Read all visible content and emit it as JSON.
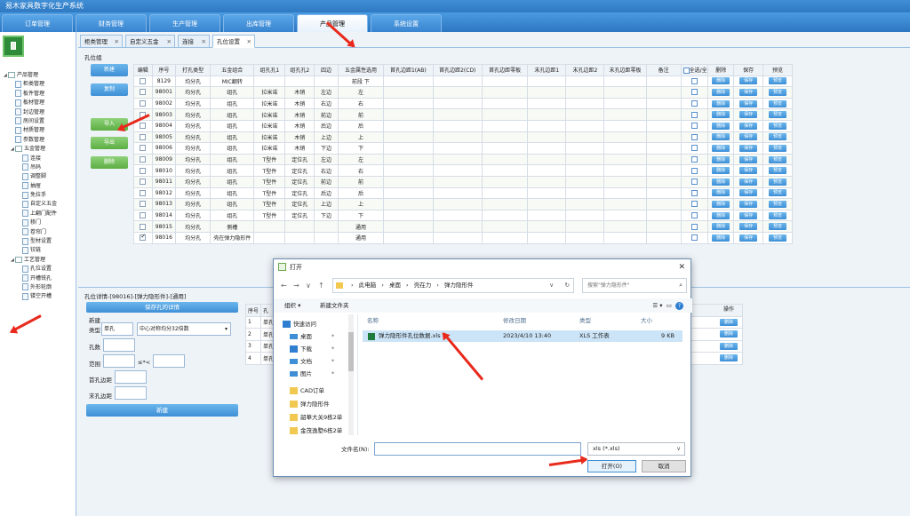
{
  "app": {
    "title": "易木家具数字化生产系统"
  },
  "topnav": [
    "订单管理",
    "财务管理",
    "生产管理",
    "出库管理",
    "产品管理",
    "系统设置"
  ],
  "tree": [
    {
      "label": "产品管理",
      "level": 0,
      "kind": "folder"
    },
    {
      "label": "柜类管理",
      "level": 1
    },
    {
      "label": "板件管理",
      "level": 1
    },
    {
      "label": "板材管理",
      "level": 1
    },
    {
      "label": "封边管理",
      "level": 1
    },
    {
      "label": "房间设置",
      "level": 1
    },
    {
      "label": "材质管理",
      "level": 1
    },
    {
      "label": "参数管理",
      "level": 1
    },
    {
      "label": "五金管理",
      "level": 1,
      "kind": "folder"
    },
    {
      "label": "连接",
      "level": 2
    },
    {
      "label": "吊码",
      "level": 2
    },
    {
      "label": "调整脚",
      "level": 2
    },
    {
      "label": "抽屉",
      "level": 2
    },
    {
      "label": "免拉手",
      "level": 2
    },
    {
      "label": "自定义五金",
      "level": 2
    },
    {
      "label": "上翻门配件",
      "level": 2
    },
    {
      "label": "移门",
      "level": 2
    },
    {
      "label": "卷帘门",
      "level": 2
    },
    {
      "label": "型材设置",
      "level": 2
    },
    {
      "label": "铰链",
      "level": 2
    },
    {
      "label": "工艺管理",
      "level": 1,
      "kind": "folder"
    },
    {
      "label": "孔位设置",
      "level": 2
    },
    {
      "label": "开槽铣孔",
      "level": 2
    },
    {
      "label": "外形轮廓",
      "level": 2
    },
    {
      "label": "镂空开槽",
      "level": 2
    }
  ],
  "pagetabs": [
    "柜类管理",
    "自定义五金",
    "连接",
    "孔位设置"
  ],
  "group_label": "孔位组",
  "buttons": {
    "new": "新建",
    "copy": "复制",
    "import": "导入",
    "export": "导出",
    "delete": "删除"
  },
  "table": {
    "headers": [
      "编辑",
      "序号",
      "打孔类型",
      "五金组合",
      "组孔孔1",
      "组孔孔2",
      "四边",
      "五金属性选用",
      "首孔边距1(AB)",
      "首孔边距2(CD)",
      "首孔边距零板",
      "末孔边距1",
      "末孔边距2",
      "末孔边距零板",
      "备注",
      "全选/全不选",
      "删除",
      "保存",
      "预览"
    ],
    "rows": [
      {
        "checked": false,
        "id": "8129",
        "type": "均分孔",
        "combo": "MIC翻转",
        "h1": "",
        "h2": "",
        "side": "",
        "attr": "前段 下"
      },
      {
        "checked": false,
        "id": "98001",
        "type": "均分孔",
        "combo": "组孔",
        "h1": "拉米诺",
        "h2": "木销",
        "side": "左边",
        "attr": "左"
      },
      {
        "checked": false,
        "id": "98002",
        "type": "均分孔",
        "combo": "组孔",
        "h1": "拉米诺",
        "h2": "木销",
        "side": "右边",
        "attr": "右"
      },
      {
        "checked": false,
        "id": "98003",
        "type": "均分孔",
        "combo": "组孔",
        "h1": "拉米诺",
        "h2": "木销",
        "side": "前边",
        "attr": "前"
      },
      {
        "checked": false,
        "id": "98004",
        "type": "均分孔",
        "combo": "组孔",
        "h1": "拉米诺",
        "h2": "木销",
        "side": "后边",
        "attr": "后"
      },
      {
        "checked": false,
        "id": "98005",
        "type": "均分孔",
        "combo": "组孔",
        "h1": "拉米诺",
        "h2": "木销",
        "side": "上边",
        "attr": "上"
      },
      {
        "checked": false,
        "id": "98006",
        "type": "均分孔",
        "combo": "组孔",
        "h1": "拉米诺",
        "h2": "木销",
        "side": "下边",
        "attr": "下"
      },
      {
        "checked": false,
        "id": "98009",
        "type": "均分孔",
        "combo": "组孔",
        "h1": "T型件",
        "h2": "定位孔",
        "side": "左边",
        "attr": "左"
      },
      {
        "checked": false,
        "id": "98010",
        "type": "均分孔",
        "combo": "组孔",
        "h1": "T型件",
        "h2": "定位孔",
        "side": "右边",
        "attr": "右"
      },
      {
        "checked": false,
        "id": "98011",
        "type": "均分孔",
        "combo": "组孔",
        "h1": "T型件",
        "h2": "定位孔",
        "side": "前边",
        "attr": "前"
      },
      {
        "checked": false,
        "id": "98012",
        "type": "均分孔",
        "combo": "组孔",
        "h1": "T型件",
        "h2": "定位孔",
        "side": "后边",
        "attr": "后"
      },
      {
        "checked": false,
        "id": "98013",
        "type": "均分孔",
        "combo": "组孔",
        "h1": "T型件",
        "h2": "定位孔",
        "side": "上边",
        "attr": "上"
      },
      {
        "checked": false,
        "id": "98014",
        "type": "均分孔",
        "combo": "组孔",
        "h1": "T型件",
        "h2": "定位孔",
        "side": "下边",
        "attr": "下"
      },
      {
        "checked": false,
        "id": "98015",
        "type": "均分孔",
        "combo": "侧槽",
        "h1": "",
        "h2": "",
        "side": "",
        "attr": "通用"
      },
      {
        "checked": true,
        "id": "98016",
        "type": "均分孔",
        "combo": "壳在弹力隐形件",
        "h1": "",
        "h2": "",
        "side": "",
        "attr": "通用"
      }
    ],
    "row_buttons": {
      "delete": "删除",
      "save": "保存",
      "preview": "预览"
    }
  },
  "detail": {
    "label": "孔位详情-[98016]-[弹力隐形件]-[通用]",
    "save_button": "保存孔的详情",
    "new_label": "新建",
    "type_label": "类型",
    "type_value": "单孔",
    "mode_value": "中心对称均分32倍数",
    "count_label": "孔数",
    "range_label": "范围",
    "range_mid": "≤*<",
    "first_margin_label": "首孔边距",
    "last_margin_label": "末孔边距",
    "new_button": "新建",
    "table_headers": [
      "序号",
      "孔"
    ],
    "rows": [
      {
        "no": "1",
        "name": "单孔"
      },
      {
        "no": "2",
        "name": "单孔"
      },
      {
        "no": "3",
        "name": "单孔"
      },
      {
        "no": "4",
        "name": "单孔"
      }
    ],
    "op_header": "操作",
    "op_button": "删除"
  },
  "dialog": {
    "title": "打开",
    "path": [
      "此电脑",
      "桌面",
      "壳在力",
      "弹力隐形件"
    ],
    "search_placeholder": "搜索\"弹力隐形件\"",
    "organize": "组织 ▾",
    "new_folder": "新建文件夹",
    "nav": [
      {
        "label": "快速访问",
        "icon": "star"
      },
      {
        "label": "桌面",
        "icon": "desktop"
      },
      {
        "label": "下载",
        "icon": "download"
      },
      {
        "label": "文档",
        "icon": "document"
      },
      {
        "label": "图片",
        "icon": "picture"
      },
      {
        "label": "CAD订单",
        "icon": "folder"
      },
      {
        "label": "弹力隐形件",
        "icon": "folder"
      },
      {
        "label": "韶華大关9栋2单",
        "icon": "folder"
      },
      {
        "label": "金茂逸墅6栋2单",
        "icon": "folder"
      }
    ],
    "columns": [
      "名称",
      "修改日期",
      "类型",
      "大小"
    ],
    "file": {
      "name": "弹力隐形件孔位数据.xls",
      "date": "2023/4/10 13:40",
      "type": "XLS 工作表",
      "size": "9 KB"
    },
    "filename_label": "文件名(N):",
    "filetype": "xls (*.xls)",
    "open_button": "打开(O)",
    "cancel_button": "取消"
  },
  "colors": {
    "primary": "#3e8fd6",
    "green": "#5cae43",
    "arrow": "#e8291c"
  }
}
